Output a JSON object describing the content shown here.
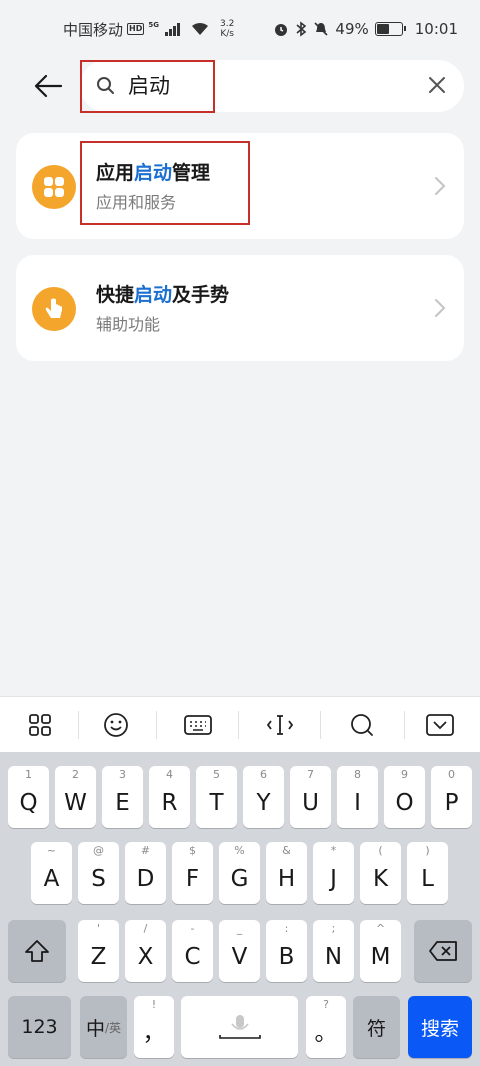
{
  "status_bar": {
    "carrier": "中国移动",
    "hd": "HD",
    "network": "5G",
    "speed_value": "3.2",
    "speed_unit": "K/s",
    "battery": "49%",
    "battery_level": 0.49,
    "time": "10:01"
  },
  "search": {
    "query": "启动"
  },
  "results": [
    {
      "title_before": "应用",
      "title_keyword": "启动",
      "title_after": "管理",
      "subtitle": "应用和服务",
      "icon": "apps-grid-icon"
    },
    {
      "title_before": "快捷",
      "title_keyword": "启动",
      "title_after": "及手势",
      "subtitle": "辅助功能",
      "icon": "gesture-hand-icon"
    }
  ],
  "keyboard": {
    "toolbar": [
      "grid-icon",
      "emoji-icon",
      "keyboard-icon",
      "cursor-icon",
      "search-icon",
      "hide-keyboard-icon"
    ],
    "row1": [
      {
        "k": "Q",
        "n": "1"
      },
      {
        "k": "W",
        "n": "2"
      },
      {
        "k": "E",
        "n": "3"
      },
      {
        "k": "R",
        "n": "4"
      },
      {
        "k": "T",
        "n": "5"
      },
      {
        "k": "Y",
        "n": "6"
      },
      {
        "k": "U",
        "n": "7"
      },
      {
        "k": "I",
        "n": "8"
      },
      {
        "k": "O",
        "n": "9"
      },
      {
        "k": "P",
        "n": "0"
      }
    ],
    "row2": [
      {
        "k": "A",
        "n": "~"
      },
      {
        "k": "S",
        "n": "@"
      },
      {
        "k": "D",
        "n": "#"
      },
      {
        "k": "F",
        "n": "$"
      },
      {
        "k": "G",
        "n": "%"
      },
      {
        "k": "H",
        "n": "&"
      },
      {
        "k": "J",
        "n": "*"
      },
      {
        "k": "K",
        "n": "("
      },
      {
        "k": "L",
        "n": ")"
      }
    ],
    "row3": [
      {
        "k": "Z",
        "n": "'"
      },
      {
        "k": "X",
        "n": "/"
      },
      {
        "k": "C",
        "n": "-"
      },
      {
        "k": "V",
        "n": "_"
      },
      {
        "k": "B",
        "n": ":"
      },
      {
        "k": "N",
        "n": ";"
      },
      {
        "k": "M",
        "n": "^"
      }
    ],
    "num_key": "123",
    "lang_main": "中",
    "lang_alt": "/英",
    "comma": "，",
    "comma_alt": "!",
    "period": "。",
    "period_alt": "?",
    "symbol": "符",
    "search_key": "搜索"
  },
  "colors": {
    "keyword": "#1a6fd1",
    "icon_bg": "#f4a52c",
    "highlight_box": "#c7302a",
    "search_key": "#0a59f7"
  }
}
